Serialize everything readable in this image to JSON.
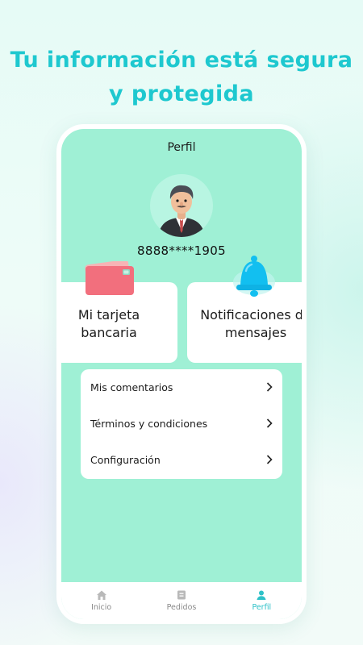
{
  "headline": {
    "line1": "Tu información está segura",
    "line2": "y protegida"
  },
  "screen": {
    "title": "Perfil",
    "phone_number": "8888****1905"
  },
  "feature_cards": [
    {
      "line1": "Mi tarjeta",
      "line2": "bancaria",
      "icon": "credit-card-icon"
    },
    {
      "line1": "Notificaciones de",
      "line2": "mensajes",
      "icon": "bell-icon"
    }
  ],
  "menu": {
    "items": [
      {
        "label": "Mis comentarios"
      },
      {
        "label": "Términos y condiciones"
      },
      {
        "label": "Configuración"
      }
    ]
  },
  "tabbar": {
    "tabs": [
      {
        "label": "Inicio",
        "icon": "home-icon",
        "active": false
      },
      {
        "label": "Pedidos",
        "icon": "orders-icon",
        "active": false
      },
      {
        "label": "Perfil",
        "icon": "profile-icon",
        "active": true
      }
    ]
  },
  "colors": {
    "accent": "#1ec8cf",
    "screen_bg": "#9ff0d5",
    "card_pink": "#f26f7d",
    "bell_blue": "#12bff0"
  }
}
